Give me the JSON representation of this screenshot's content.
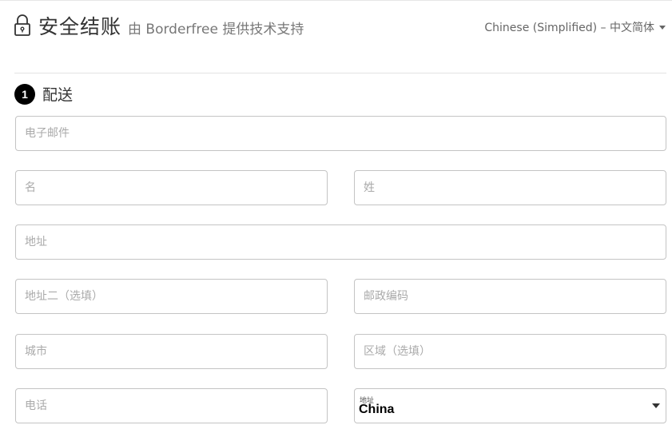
{
  "header": {
    "title": "安全结账",
    "subtitle": "由 Borderfree 提供技术支持",
    "language": "Chinese (Simplified) – 中文简体"
  },
  "section": {
    "step": "1",
    "title": "配送"
  },
  "form": {
    "email_placeholder": "电子邮件",
    "first_name_placeholder": "名",
    "last_name_placeholder": "姓",
    "address_placeholder": "地址",
    "address2_placeholder": "地址二（选填）",
    "postal_code_placeholder": "邮政编码",
    "city_placeholder": "城市",
    "region_placeholder": "区域（选填）",
    "phone_placeholder": "电话",
    "country_label": "地址",
    "country_value": "China"
  },
  "icons": {
    "lock": "lock-icon",
    "language_caret": "caret-down-icon",
    "country_arrow": "dropdown-arrow-icon"
  },
  "colors": {
    "border": "#c4c4c4",
    "placeholder": "#aaaaaa",
    "badge": "#000000"
  }
}
